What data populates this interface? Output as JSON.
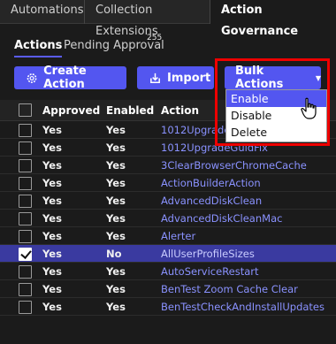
{
  "tabs": [
    {
      "label": "Automations"
    },
    {
      "label": "Collection Extensions"
    },
    {
      "label": "Action Governance"
    }
  ],
  "active_tab": "Action Governance",
  "subtabs": {
    "actions": "Actions",
    "pending": "Pending Approval",
    "pending_count": "255"
  },
  "toolbar": {
    "create_label": "Create Action",
    "import_label": "Import",
    "bulk_label": "Bulk Actions"
  },
  "bulk_menu": {
    "items": [
      "Enable",
      "Disable",
      "Delete"
    ],
    "highlighted": "Enable"
  },
  "table": {
    "headers": {
      "approved": "Approved",
      "enabled": "Enabled",
      "action": "Action"
    },
    "rows": [
      {
        "approved": "Yes",
        "enabled": "Yes",
        "action": "1012UpgradeFix",
        "checked": false
      },
      {
        "approved": "Yes",
        "enabled": "Yes",
        "action": "1012UpgradeGuidFix",
        "checked": false
      },
      {
        "approved": "Yes",
        "enabled": "Yes",
        "action": "3ClearBrowserChromeCache",
        "checked": false
      },
      {
        "approved": "Yes",
        "enabled": "Yes",
        "action": "ActionBuilderAction",
        "checked": false
      },
      {
        "approved": "Yes",
        "enabled": "Yes",
        "action": "AdvancedDiskClean",
        "checked": false
      },
      {
        "approved": "Yes",
        "enabled": "Yes",
        "action": "AdvancedDiskCleanMac",
        "checked": false
      },
      {
        "approved": "Yes",
        "enabled": "Yes",
        "action": "Alerter",
        "checked": false
      },
      {
        "approved": "Yes",
        "enabled": "No",
        "action": "AllUserProfileSizes",
        "checked": true
      },
      {
        "approved": "Yes",
        "enabled": "Yes",
        "action": "AutoServiceRestart",
        "checked": false
      },
      {
        "approved": "Yes",
        "enabled": "Yes",
        "action": "BenTest Zoom Cache Clear",
        "checked": false
      },
      {
        "approved": "Yes",
        "enabled": "Yes",
        "action": "BenTestCheckAndInstallUpdates",
        "checked": false
      }
    ]
  },
  "colors": {
    "accent": "#5356f0",
    "highlight_box": "#ee0000",
    "link": "#8a92ff",
    "background": "#1b1b1b"
  }
}
